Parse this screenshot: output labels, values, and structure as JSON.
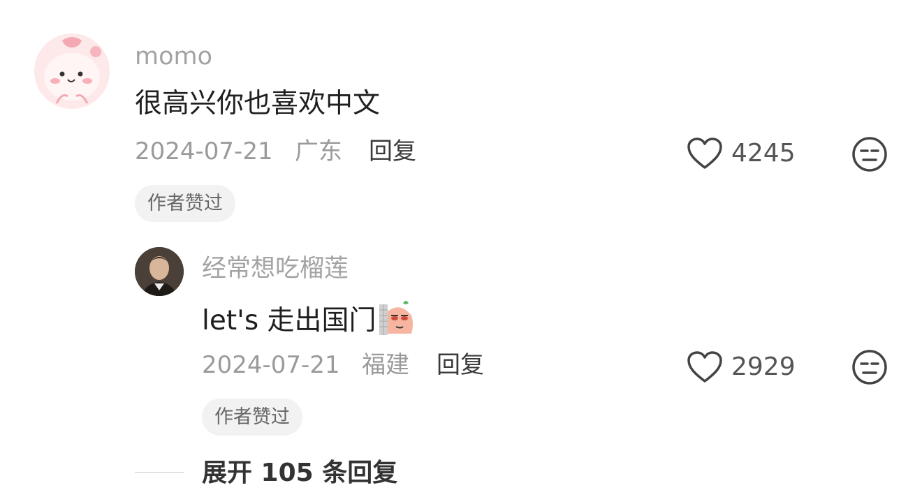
{
  "comments": [
    {
      "username": "momo",
      "text": "很高兴你也喜欢中文",
      "date": "2024-07-21",
      "location": "广东",
      "reply_label": "回复",
      "likes": "4245",
      "badge": "作者赞过"
    }
  ],
  "replies": [
    {
      "username": "经常想吃榴莲",
      "text": "let's 走出国门",
      "date": "2024-07-21",
      "location": "福建",
      "reply_label": "回复",
      "likes": "2929",
      "badge": "作者赞过"
    }
  ],
  "expand": {
    "label": "展开 105 条回复"
  },
  "icons": {
    "like": "heart-outline-icon",
    "dislike": "unamused-face-icon",
    "sticker": "peeking-bean-sticker-icon"
  },
  "colors": {
    "username": "#a3a3a3",
    "meta": "#9a9a9a",
    "badge_bg": "#f2f2f2"
  }
}
